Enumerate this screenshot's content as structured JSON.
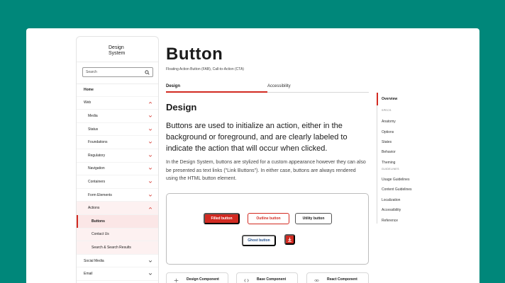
{
  "sidebar": {
    "logo_line1": "Design",
    "logo_line2": "System",
    "search_placeholder": "Search",
    "items": [
      {
        "label": "Home",
        "level": 0,
        "bold": true,
        "chevron": ""
      },
      {
        "label": "Web",
        "level": 0,
        "bold": false,
        "chevron": "up"
      },
      {
        "label": "Media",
        "level": 1,
        "bold": false,
        "chevron": "down"
      },
      {
        "label": "Status",
        "level": 1,
        "bold": false,
        "chevron": "down"
      },
      {
        "label": "Foundations",
        "level": 1,
        "bold": false,
        "chevron": "down"
      },
      {
        "label": "Regulatory",
        "level": 1,
        "bold": false,
        "chevron": "down"
      },
      {
        "label": "Navigation",
        "level": 1,
        "bold": false,
        "chevron": "down"
      },
      {
        "label": "Containers",
        "level": 1,
        "bold": false,
        "chevron": "down"
      },
      {
        "label": "Form Elements",
        "level": 1,
        "bold": false,
        "chevron": "down"
      },
      {
        "label": "Actions",
        "level": 1,
        "bold": false,
        "chevron": "up"
      },
      {
        "label": "Buttons",
        "level": 2,
        "bold": true,
        "chevron": ""
      },
      {
        "label": "Contact Us",
        "level": 2,
        "bold": false,
        "chevron": ""
      },
      {
        "label": "Search & Search Results",
        "level": 2,
        "bold": false,
        "chevron": ""
      },
      {
        "label": "Social Media",
        "level": 0,
        "bold": false,
        "chevron": "down"
      },
      {
        "label": "Email",
        "level": 0,
        "bold": false,
        "chevron": "down"
      }
    ]
  },
  "main": {
    "title": "Button",
    "subtitle": "Floating Action Button (FAB), Call-to-Action (CTA)",
    "tabs": [
      {
        "label": "Design"
      },
      {
        "label": "Accessibility"
      }
    ],
    "section_heading": "Design",
    "lead": "Buttons are used to initialize an action, either in the background or foreground, and are clearly labeled to indicate the action that will occur when clicked.",
    "body": "In the Design System, buttons are stylized for a custom appearance however they can also be presented as text links (\"Link Buttons\"). In either case, buttons are always rendered using the HTML button element.",
    "demo": {
      "filled": "Filled button",
      "outline": "Outline button",
      "utility": "Utility button",
      "ghost": "Ghost button",
      "icon": "download-icon"
    },
    "cards": [
      {
        "label": "Design Component",
        "icon": "figma-icon"
      },
      {
        "label": "Base Component",
        "icon": "code-icon"
      },
      {
        "label": "React Component",
        "icon": "react-icon"
      }
    ]
  },
  "toc": {
    "overview": "Overview",
    "specs_heading": "SPECS",
    "specs": [
      "Anatomy",
      "Options",
      "States",
      "Behavior",
      "Theming"
    ],
    "guidelines_heading": "GUIDELINES",
    "guidelines": [
      "Usage Guidelines",
      "Content Guidelines",
      "Localization",
      "Accessibility",
      "Reference"
    ]
  },
  "colors": {
    "background": "#00877a",
    "accent": "#d22a21",
    "ghost": "#1f4e8c"
  }
}
